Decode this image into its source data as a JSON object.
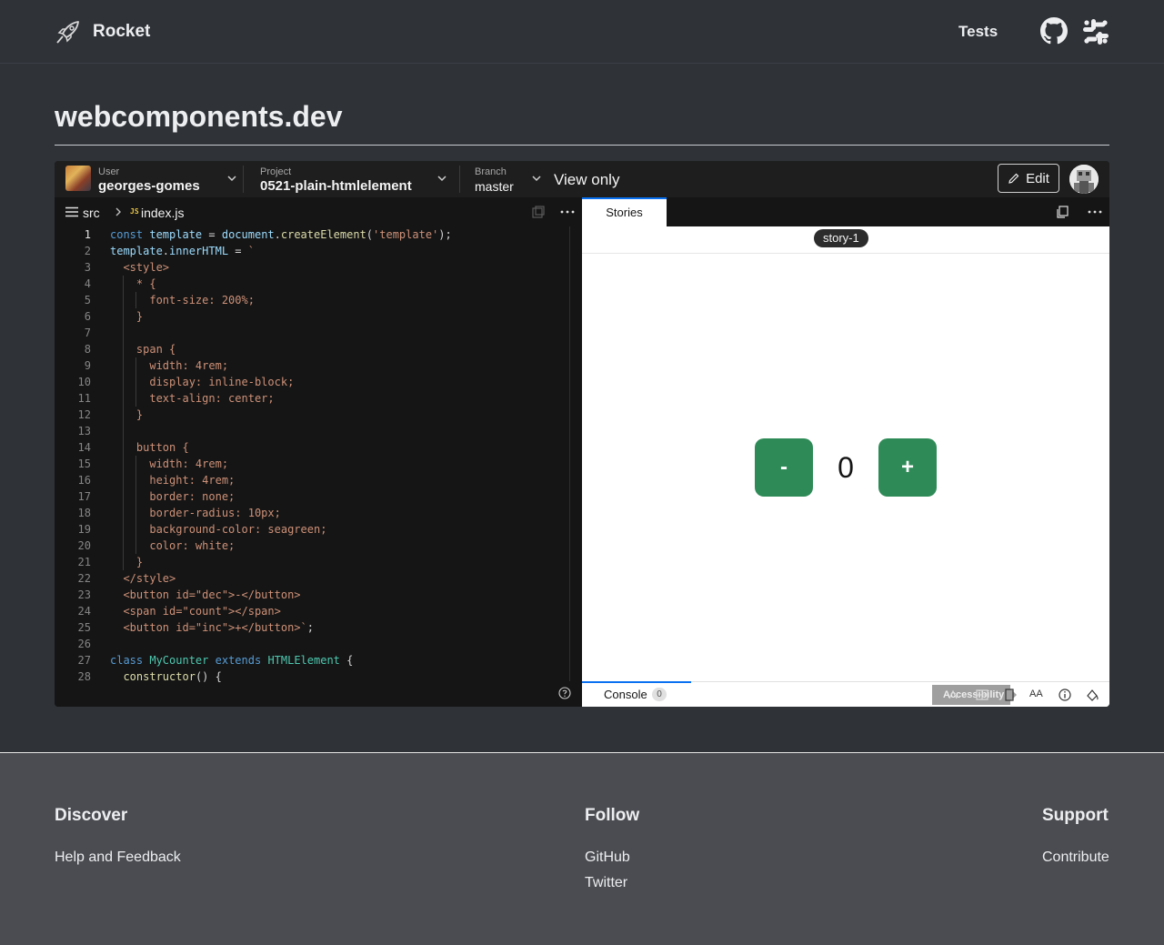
{
  "header": {
    "brand": "Rocket",
    "nav_tests": "Tests",
    "icons": [
      "rocket-logo-icon",
      "github-icon",
      "slack-icon"
    ]
  },
  "page": {
    "title": "webcomponents.dev"
  },
  "embed": {
    "user_label": "User",
    "user_value": "georges-gomes",
    "project_label": "Project",
    "project_value": "0521-plain-htmlelement",
    "branch_label": "Branch",
    "branch_value": "master",
    "mode": "View only",
    "edit_label": "Edit"
  },
  "editor": {
    "breadcrumb_folder": "src",
    "js_badge": "JS",
    "file_name": "index.js",
    "active_line": 1
  },
  "preview": {
    "tab_stories": "Stories",
    "story_name": "story-1",
    "dec_label": "-",
    "inc_label": "+",
    "count": "0",
    "console_label": "Console",
    "console_count": "0",
    "accessibility_label": "Accessibility",
    "font_toggle_label": "AA"
  },
  "footer": {
    "discover": {
      "heading": "Discover",
      "links": [
        "Help and Feedback"
      ]
    },
    "follow": {
      "heading": "Follow",
      "links": [
        "GitHub",
        "Twitter"
      ]
    },
    "support": {
      "heading": "Support",
      "links": [
        "Contribute"
      ]
    }
  },
  "colors": {
    "page_bg": "#2f3237",
    "footer_bg": "#4a4c51",
    "editor_bg": "#151515",
    "accent_tab": "#0971f1",
    "counter_button": "#2e8b57"
  }
}
